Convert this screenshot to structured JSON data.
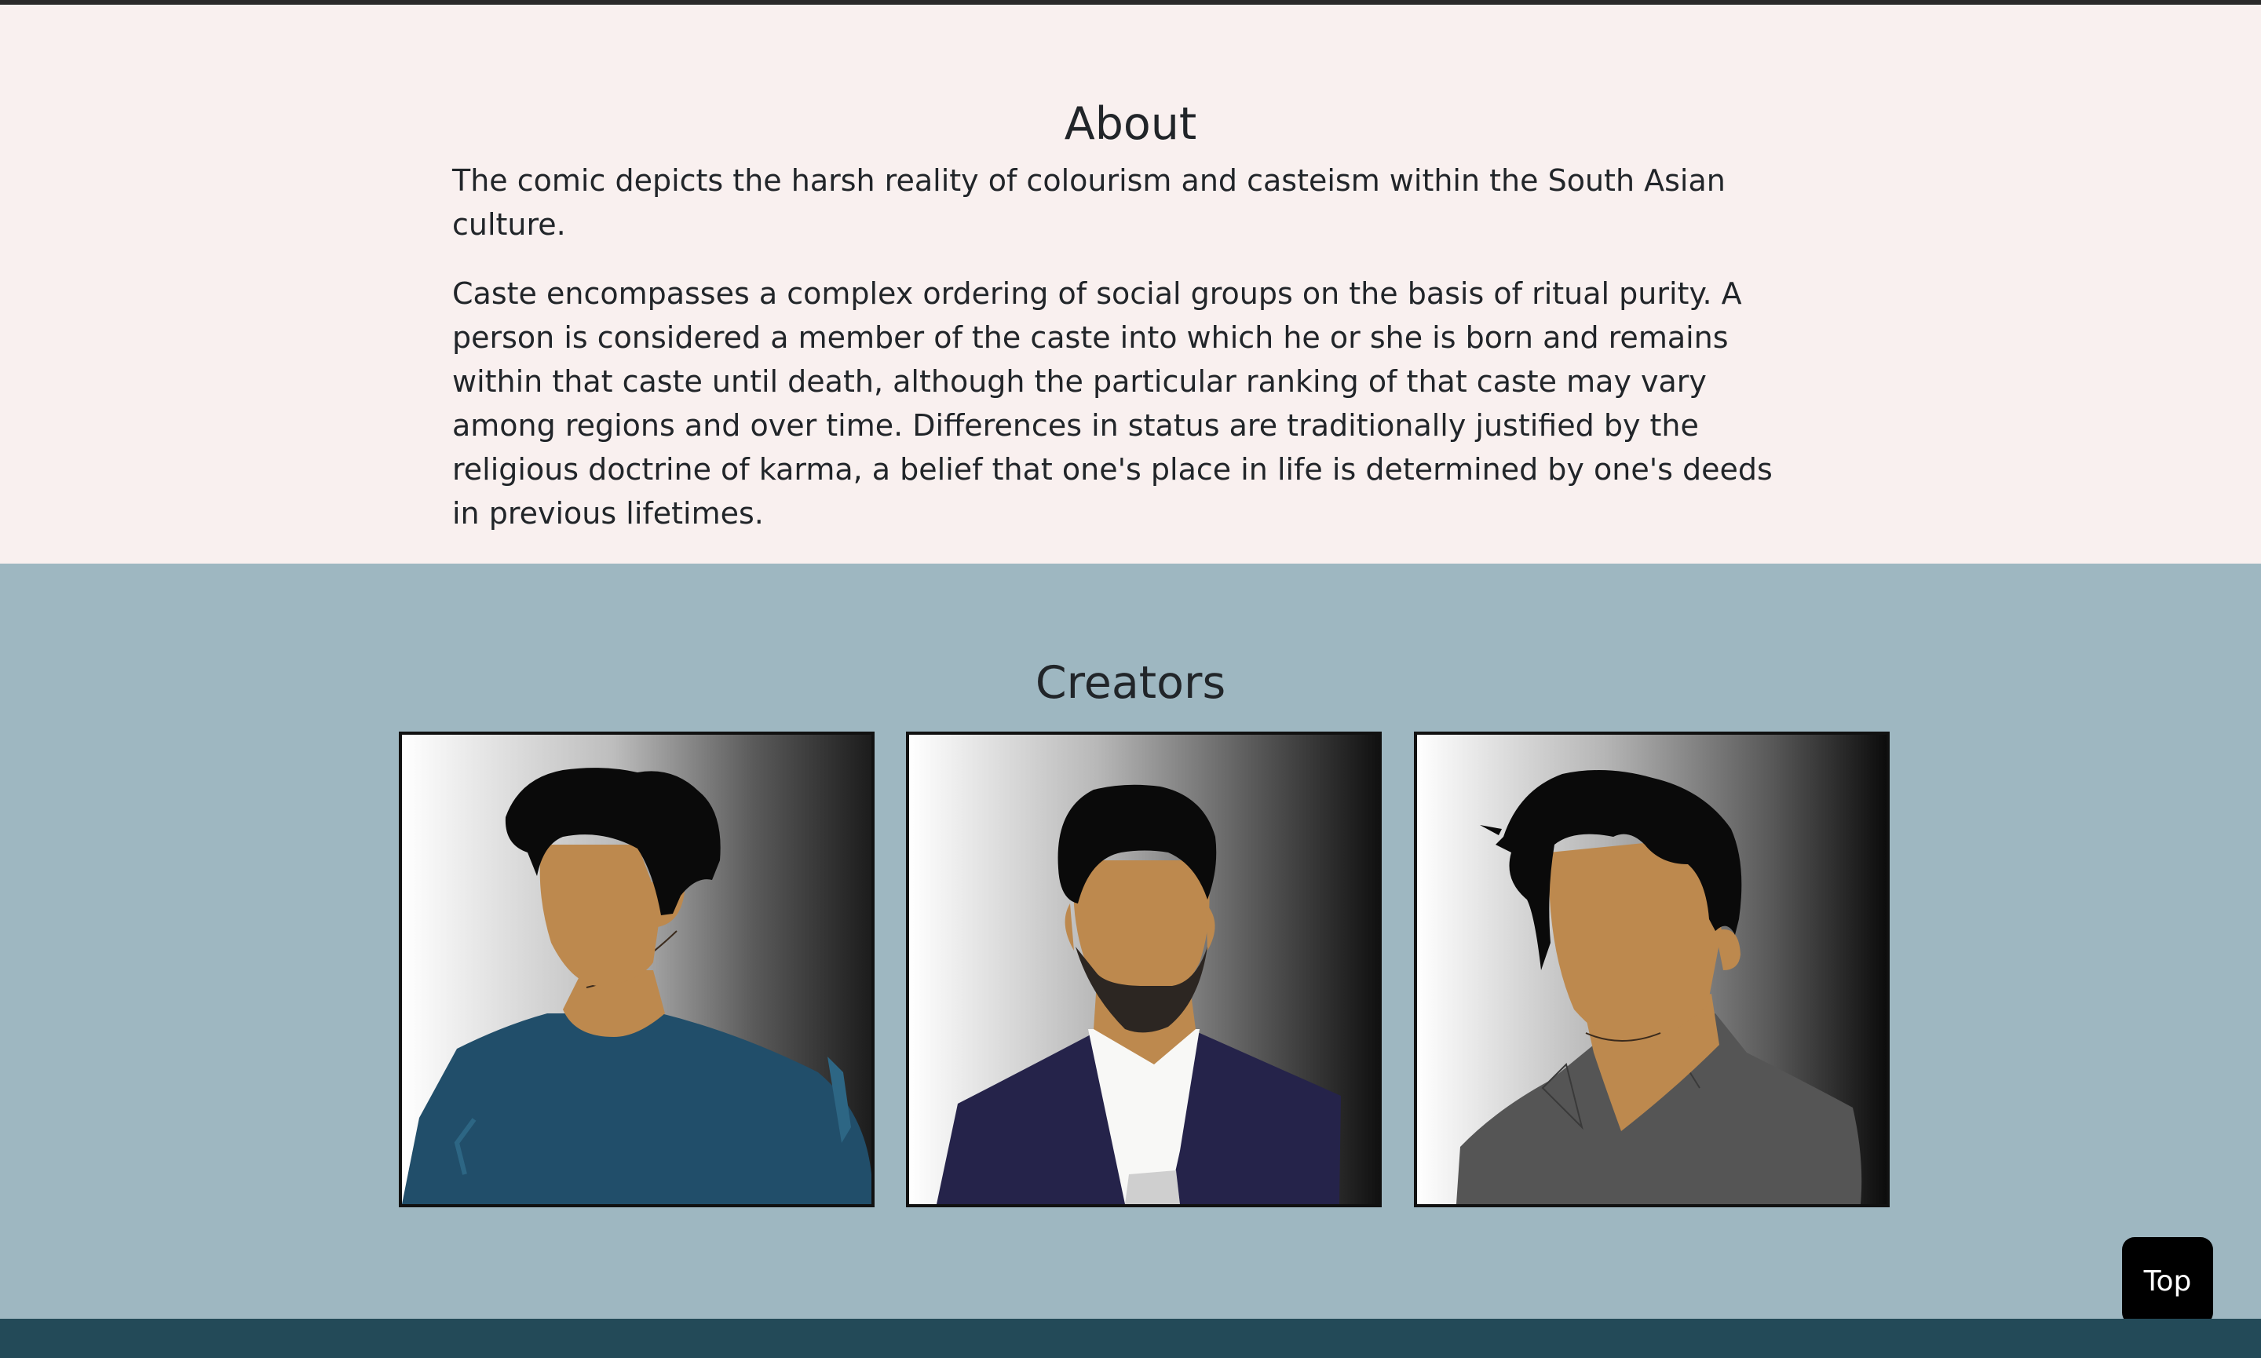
{
  "about": {
    "heading": "About",
    "paragraphs": [
      "The comic depicts the harsh reality of colourism and casteism within the South Asian culture.",
      "Caste encompasses a complex ordering of social groups on the basis of ritual purity. A person is considered a member of the caste into which he or she is born and remains within that caste until death, although the particular ranking of that caste may vary among regions and over time. Differences in status are traditionally justified by the religious doctrine of karma, a belief that one's place in life is determined by one's deeds in previous lifetimes."
    ]
  },
  "creators": {
    "heading": "Creators",
    "portraits": [
      {
        "icon": "creator-portrait-teal-shirt",
        "shirt_color": "#214e6a"
      },
      {
        "icon": "creator-portrait-navy-suit-beard",
        "shirt_color": "#25234a"
      },
      {
        "icon": "creator-portrait-grey-shirt",
        "shirt_color": "#555555"
      }
    ]
  },
  "back_to_top": {
    "label": "Top"
  },
  "colors": {
    "about_bg": "#f9f0ef",
    "creators_bg": "#9eb7c1",
    "footer_bg": "#234a58",
    "skin": "#bd894e",
    "hair": "#0a0a0a"
  }
}
